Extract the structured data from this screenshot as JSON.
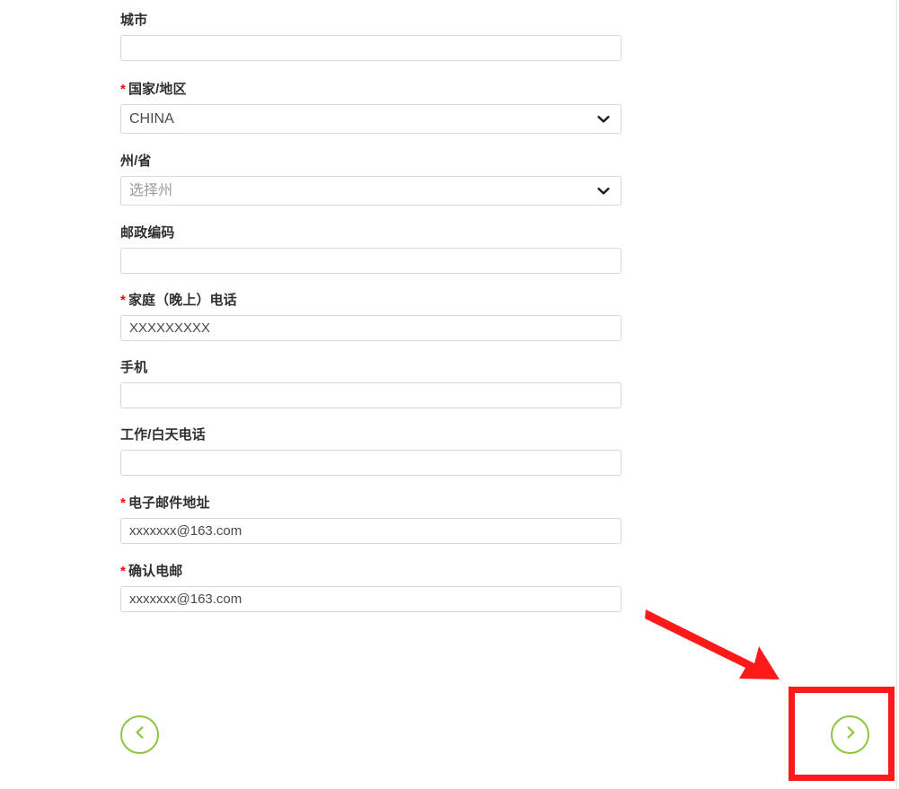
{
  "form": {
    "fields": [
      {
        "key": "city",
        "label": "城市",
        "required": false,
        "type": "text",
        "value": "",
        "placeholder": ""
      },
      {
        "key": "country_region",
        "label": "国家/地区",
        "required": true,
        "type": "select",
        "value": "CHINA",
        "is_placeholder": false
      },
      {
        "key": "state_province",
        "label": "州/省",
        "required": false,
        "type": "select",
        "value": "选择州",
        "is_placeholder": true
      },
      {
        "key": "postal_code",
        "label": "邮政编码",
        "required": false,
        "type": "text",
        "value": "",
        "placeholder": ""
      },
      {
        "key": "home_phone",
        "label": "家庭（晚上）电话",
        "required": true,
        "type": "text",
        "value": "XXXXXXXXX",
        "placeholder": ""
      },
      {
        "key": "mobile_phone",
        "label": "手机",
        "required": false,
        "type": "text",
        "value": "",
        "placeholder": ""
      },
      {
        "key": "work_phone",
        "label": "工作/白天电话",
        "required": false,
        "type": "text",
        "value": "",
        "placeholder": ""
      },
      {
        "key": "email",
        "label": "电子邮件地址",
        "required": true,
        "type": "text",
        "value": "xxxxxxx@163.com",
        "placeholder": ""
      },
      {
        "key": "email_confirm",
        "label": "确认电邮",
        "required": true,
        "type": "text",
        "value": "xxxxxxx@163.com",
        "placeholder": ""
      }
    ],
    "required_marker": "*"
  },
  "navigation": {
    "back": {
      "icon": "chevron-left-icon",
      "label": ""
    },
    "next": {
      "icon": "chevron-right-icon",
      "label": ""
    }
  },
  "annotation": {
    "arrow": "red-arrow-pointing-to-next-button",
    "highlight": "red-rectangle-around-next-button"
  },
  "colors": {
    "accent_green": "#8cc63e",
    "annotation_red": "#ff1a1a",
    "required_red": "#ff0000",
    "label_text": "#2f2f2f",
    "input_text": "#4a4a4a",
    "placeholder_text": "#9a9a9a",
    "input_border": "#d8d8d8",
    "background": "#ffffff"
  }
}
